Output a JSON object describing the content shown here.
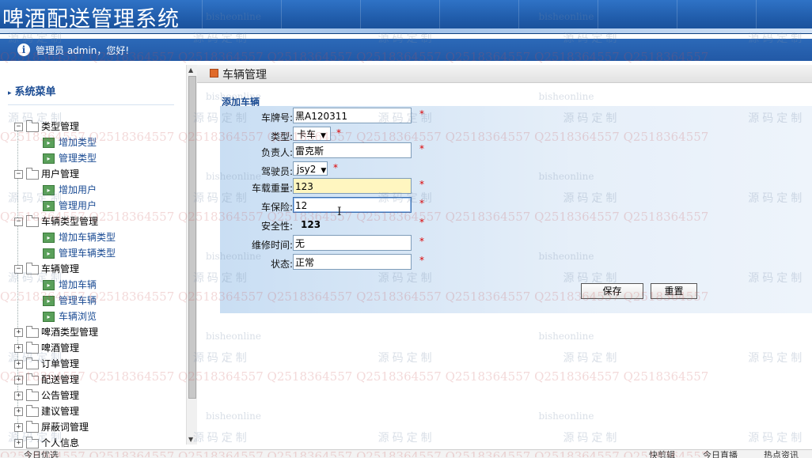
{
  "header": {
    "title": "啤酒配送管理系统"
  },
  "userbar": {
    "greeting": "管理员 admin，您好!",
    "info_icon": "info-icon"
  },
  "sidebar": {
    "title": "系统菜单",
    "tree": [
      {
        "label": "类型管理",
        "expanded": true,
        "children": [
          "增加类型",
          "管理类型"
        ]
      },
      {
        "label": "用户管理",
        "expanded": true,
        "children": [
          "增加用户",
          "管理用户"
        ]
      },
      {
        "label": "车辆类型管理",
        "expanded": true,
        "children": [
          "增加车辆类型",
          "管理车辆类型"
        ]
      },
      {
        "label": "车辆管理",
        "expanded": true,
        "children": [
          "增加车辆",
          "管理车辆",
          "车辆浏览"
        ]
      },
      {
        "label": "啤酒类型管理",
        "expanded": false,
        "children": []
      },
      {
        "label": "啤酒管理",
        "expanded": false,
        "children": []
      },
      {
        "label": "订单管理",
        "expanded": false,
        "children": []
      },
      {
        "label": "配送管理",
        "expanded": false,
        "children": []
      },
      {
        "label": "公告管理",
        "expanded": false,
        "children": []
      },
      {
        "label": "建议管理",
        "expanded": false,
        "children": []
      },
      {
        "label": "屏蔽词管理",
        "expanded": false,
        "children": []
      },
      {
        "label": "个人信息",
        "expanded": false,
        "children": []
      }
    ]
  },
  "main": {
    "page_title": "车辆管理",
    "form_title": "添加车辆",
    "fields": {
      "plate": {
        "label": "车牌号:",
        "value": "黑A120311"
      },
      "type": {
        "label": "类型:",
        "value": "卡车"
      },
      "owner": {
        "label": "负责人:",
        "value": "雷克斯"
      },
      "driver": {
        "label": "驾驶员:",
        "value": "jsy2"
      },
      "load": {
        "label": "车载重量:",
        "value": "123"
      },
      "insurance": {
        "label": "车保险:",
        "value": "12"
      },
      "safety": {
        "label": "安全性:",
        "value": "123"
      },
      "repair": {
        "label": "维修时间:",
        "value": "无"
      },
      "status": {
        "label": "状态:",
        "value": "正常"
      }
    },
    "required_mark": "*",
    "buttons": {
      "save": "保存",
      "reset": "重置"
    }
  },
  "watermark": {
    "site": "bisheonline",
    "brand": "源码定制",
    "qq": "Q2518364557"
  },
  "taskbar": {
    "left": "今日优选",
    "r1": "快剪辑",
    "r2": "今日直播",
    "r3": "热点资讯"
  }
}
